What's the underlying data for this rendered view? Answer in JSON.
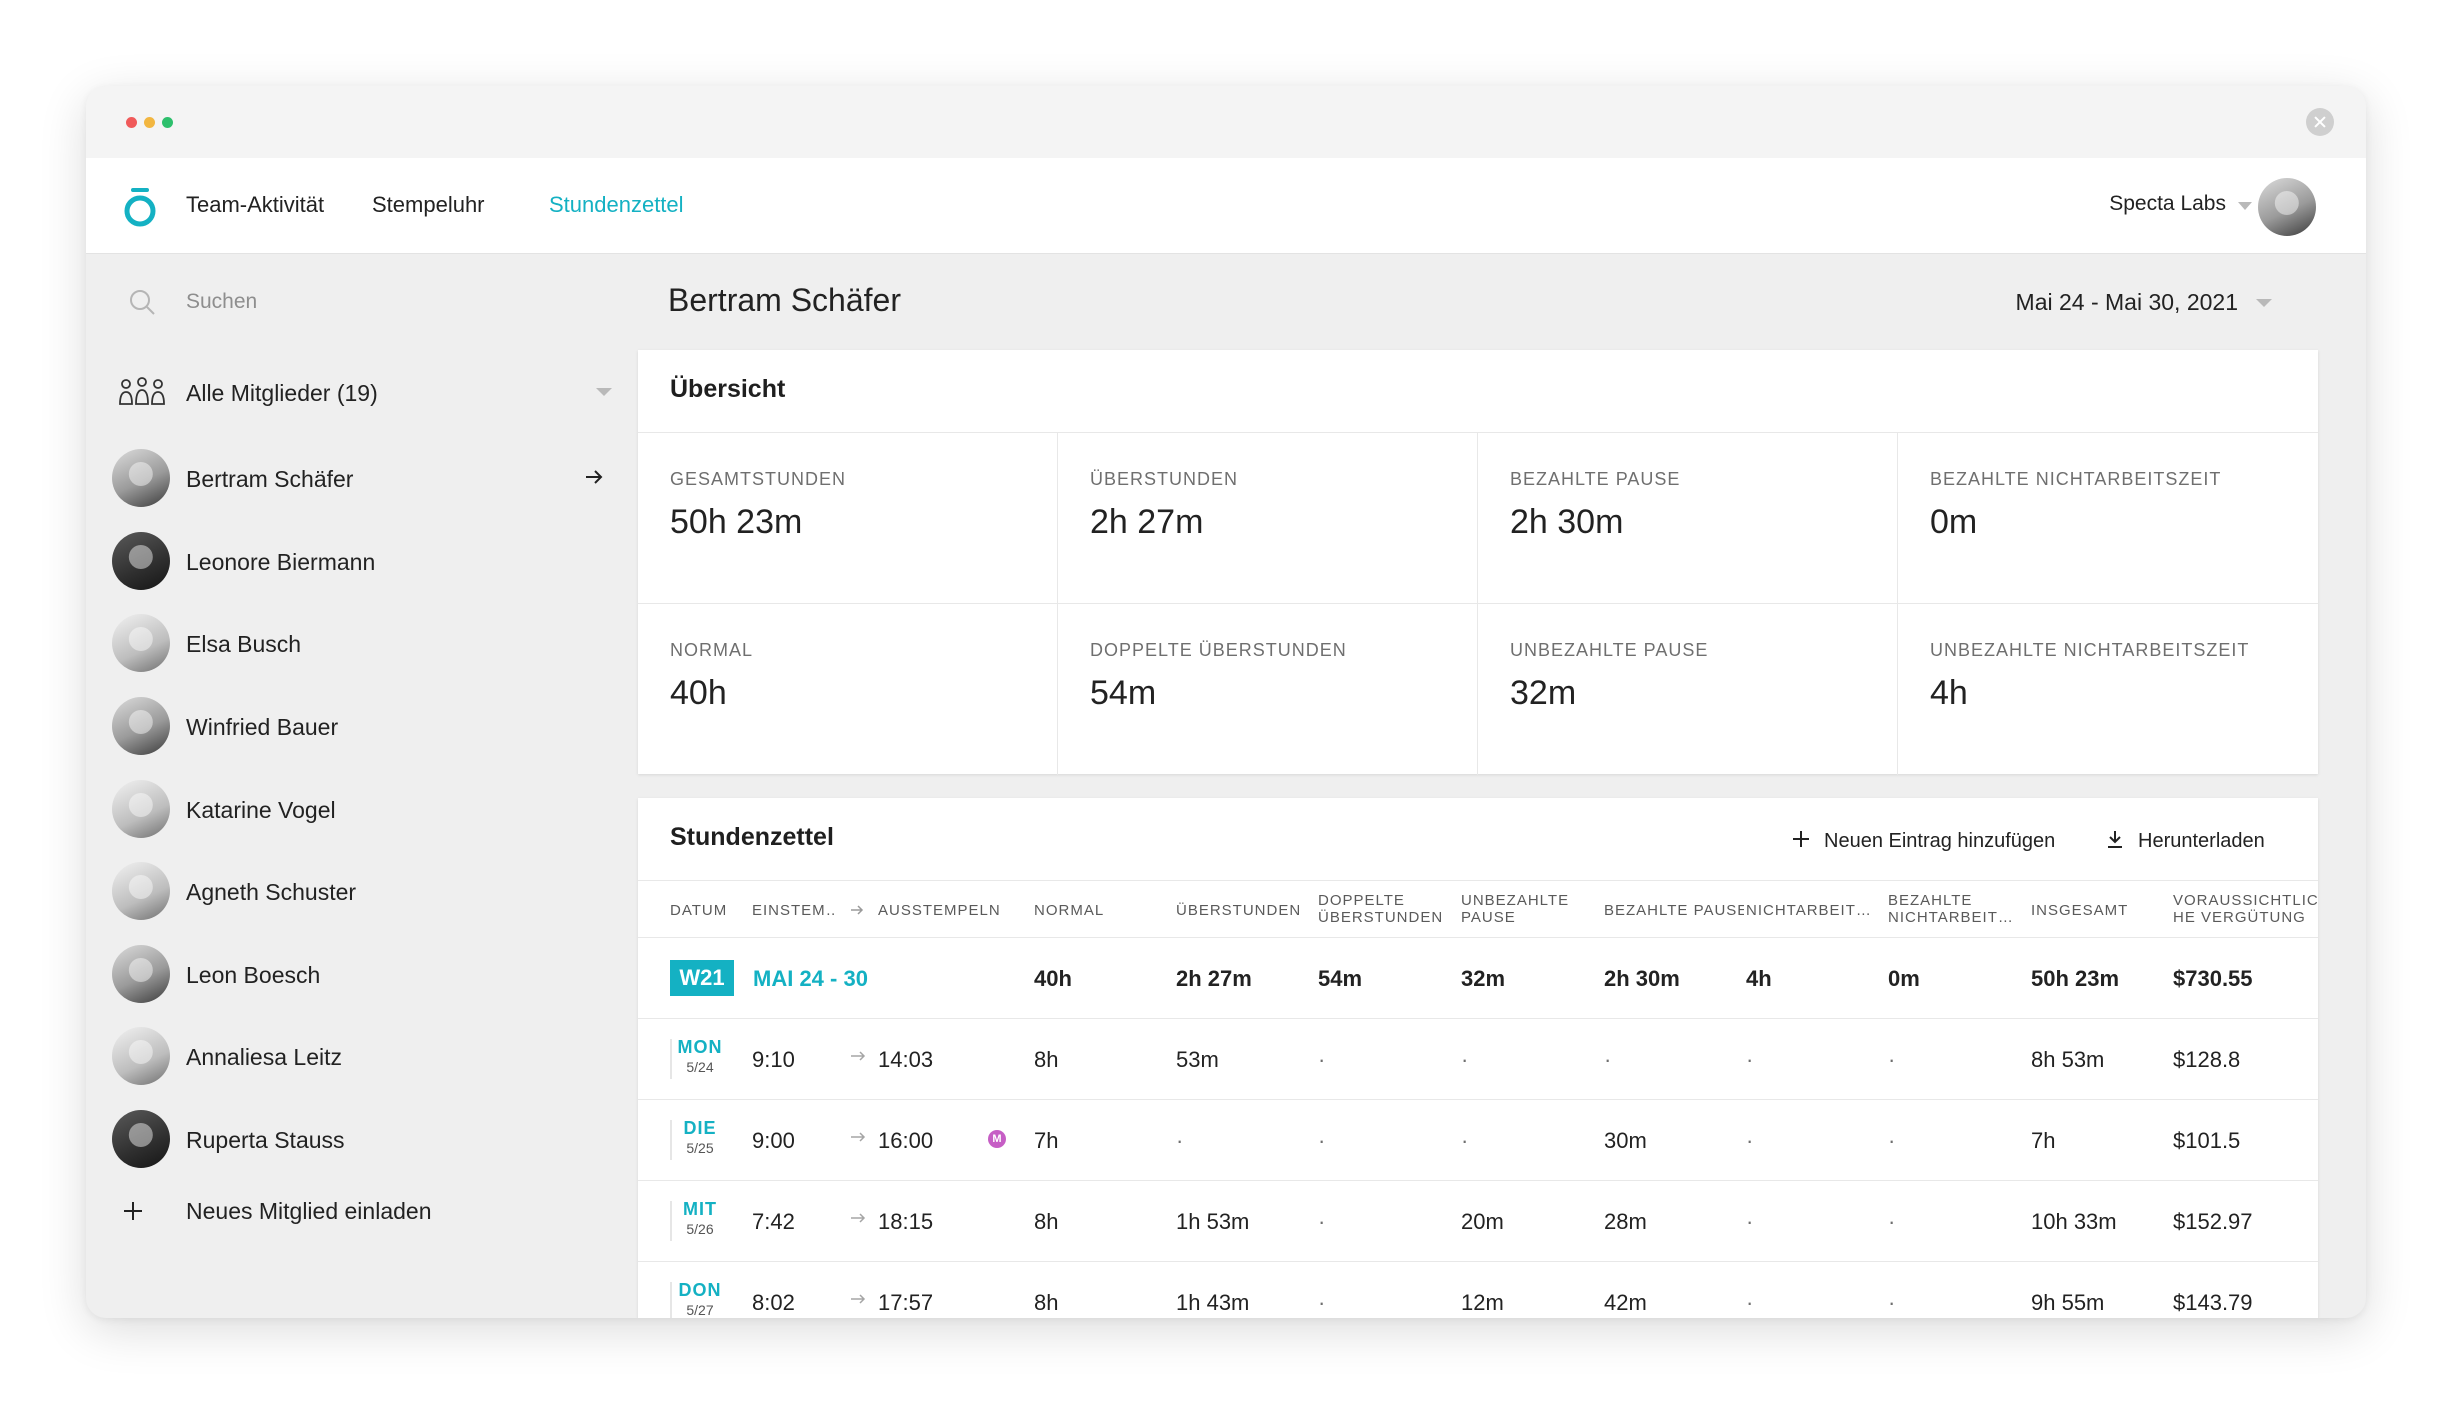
{
  "colors": {
    "accent": "#14b1c3",
    "dot_red": "#f05a5a",
    "dot_yellow": "#f2b640",
    "dot_green": "#2dbf6c",
    "marker": "#c65ec5"
  },
  "nav": {
    "links": [
      "Team-Aktivität",
      "Stempeluhr",
      "Stundenzettel"
    ],
    "active": "Stundenzettel",
    "org": "Specta Labs"
  },
  "sidebar": {
    "search_placeholder": "Suchen",
    "members_filter": "Alle Mitglieder (19)",
    "members": [
      {
        "name": "Bertram Schäfer",
        "selected": true
      },
      {
        "name": "Leonore Biermann"
      },
      {
        "name": "Elsa Busch"
      },
      {
        "name": "Winfried Bauer"
      },
      {
        "name": "Katarine Vogel"
      },
      {
        "name": "Agneth Schuster"
      },
      {
        "name": "Leon Boesch"
      },
      {
        "name": "Annaliesa Leitz"
      },
      {
        "name": "Ruperta Stauss"
      }
    ],
    "invite_label": "Neues Mitglied einladen"
  },
  "main": {
    "person": "Bertram Schäfer",
    "daterange": "Mai 24 - Mai 30, 2021",
    "overview": {
      "title": "Übersicht",
      "stats": [
        {
          "label": "GESAMTSTUNDEN",
          "value": "50h 23m"
        },
        {
          "label": "ÜBERSTUNDEN",
          "value": "2h 27m"
        },
        {
          "label": "BEZAHLTE PAUSE",
          "value": "2h 30m"
        },
        {
          "label": "BEZAHLTE NICHTARBEITSZEIT",
          "value": "0m"
        },
        {
          "label": "NORMAL",
          "value": "40h"
        },
        {
          "label": "DOPPELTE ÜBERSTUNDEN",
          "value": "54m"
        },
        {
          "label": "UNBEZAHLTE PAUSE",
          "value": "32m"
        },
        {
          "label": "UNBEZAHLTE NICHTARBEITSZEIT",
          "value": "4h"
        }
      ]
    },
    "timesheet": {
      "title": "Stundenzettel",
      "add_label": "Neuen Eintrag hinzufügen",
      "download_label": "Herunterladen",
      "headers": {
        "datum": "DATUM",
        "einstempeln": "EINSTEM…",
        "ausstempeln": "AUSSTEMPELN",
        "normal": "NORMAL",
        "ueberstunden": "ÜBERSTUNDEN",
        "doppelte_1": "DOPPELTE",
        "doppelte_2": "ÜBERSTUNDEN",
        "unbezahlte_1": "UNBEZAHLTE",
        "unbezahlte_2": "PAUSE",
        "bezahlte_pause": "BEZAHLTE PAUSE",
        "nichtarbeit": "NICHTARBEIT…",
        "bez_nicht_1": "BEZAHLTE",
        "bez_nicht_2": "NICHTARBEIT…",
        "insgesamt": "INSGESAMT",
        "verg_1": "VORAUSSICHTLIC",
        "verg_2": "HE VERGÜTUNG"
      },
      "week": {
        "badge": "W21",
        "label": "MAI 24 - 30",
        "normal": "40h",
        "ueber": "2h 27m",
        "doppelt": "54m",
        "unbez_pause": "32m",
        "bez_pause": "2h 30m",
        "nichtarbeit": "4h",
        "bez_nicht": "0m",
        "insgesamt": "50h 23m",
        "verguetung": "$730.55"
      },
      "rows": [
        {
          "day": "MON",
          "date": "5/24",
          "in": "9:10",
          "out": "14:03",
          "marker": "",
          "normal": "8h",
          "ueber": "53m",
          "doppelt": "·",
          "unbez_pause": "·",
          "bez_pause": "·",
          "nichtarbeit": "·",
          "bez_nicht": "·",
          "insgesamt": "8h 53m",
          "verguetung": "$128.8"
        },
        {
          "day": "DIE",
          "date": "5/25",
          "in": "9:00",
          "out": "16:00",
          "marker": "M",
          "normal": "7h",
          "ueber": "·",
          "doppelt": "·",
          "unbez_pause": "·",
          "bez_pause": "30m",
          "nichtarbeit": "·",
          "bez_nicht": "·",
          "insgesamt": "7h",
          "verguetung": "$101.5"
        },
        {
          "day": "MIT",
          "date": "5/26",
          "in": "7:42",
          "out": "18:15",
          "marker": "",
          "normal": "8h",
          "ueber": "1h 53m",
          "doppelt": "·",
          "unbez_pause": "20m",
          "bez_pause": "28m",
          "nichtarbeit": "·",
          "bez_nicht": "·",
          "insgesamt": "10h 33m",
          "verguetung": "$152.97"
        },
        {
          "day": "DON",
          "date": "5/27",
          "in": "8:02",
          "out": "17:57",
          "marker": "",
          "normal": "8h",
          "ueber": "1h 43m",
          "doppelt": "·",
          "unbez_pause": "12m",
          "bez_pause": "42m",
          "nichtarbeit": "·",
          "bez_nicht": "·",
          "insgesamt": "9h 55m",
          "verguetung": "$143.79"
        }
      ]
    }
  }
}
